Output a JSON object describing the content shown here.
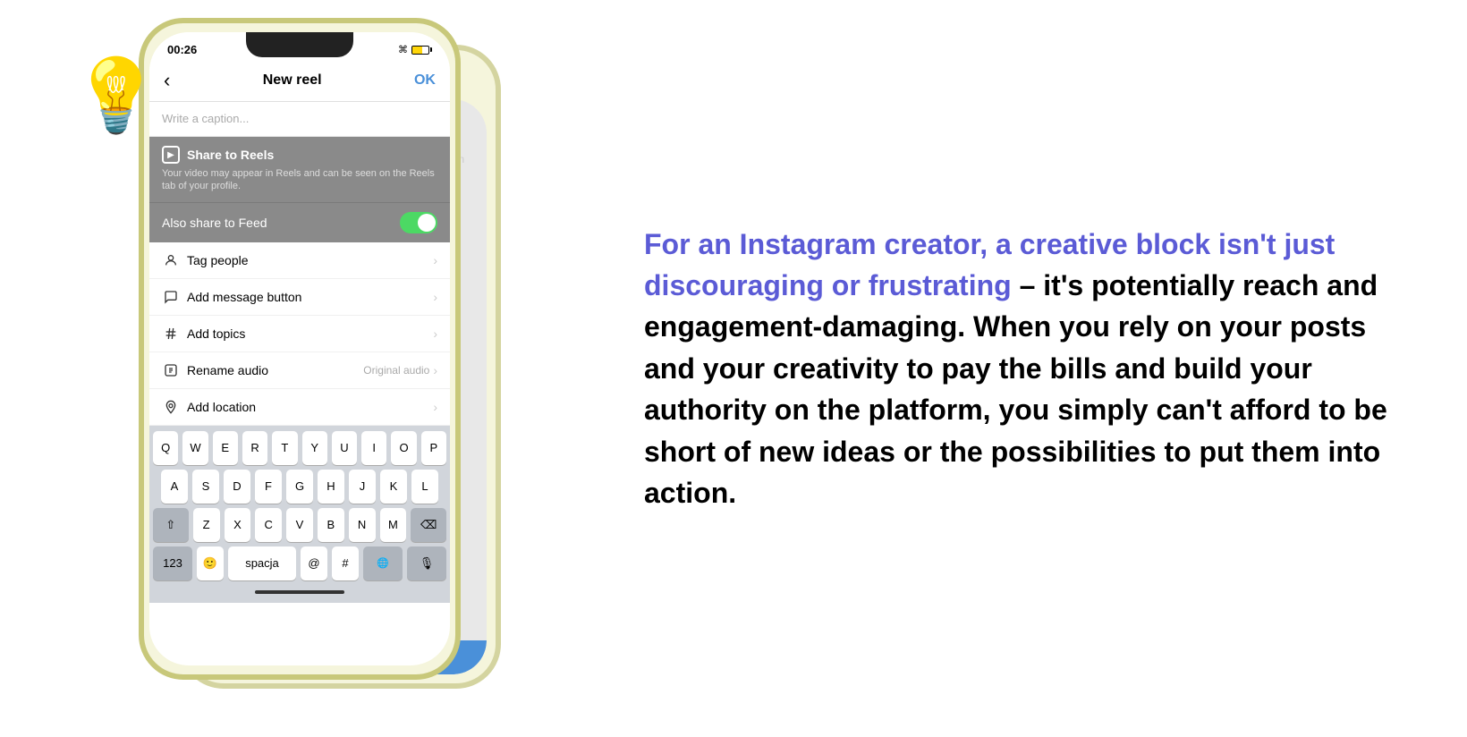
{
  "left": {
    "lightbulb": "💡",
    "phone": {
      "statusTime": "00:26",
      "statusArrow": "↑",
      "navBack": "‹",
      "navTitle": "New reel",
      "navOk": "OK",
      "captionPlaceholder": "Write a caption...",
      "shareToReels": "Share to Reels",
      "shareDesc": "Your video may appear in Reels and can be seen on the Reels tab of your profile.",
      "alsoShareFeed": "Also share to Feed",
      "menuItems": [
        {
          "icon": "👤",
          "label": "Tag people",
          "extra": ""
        },
        {
          "icon": "💬",
          "label": "Add message button",
          "extra": ""
        },
        {
          "icon": "#",
          "label": "Add topics",
          "extra": ""
        },
        {
          "icon": "🎵",
          "label": "Rename audio",
          "extra": "Original audio"
        },
        {
          "icon": "📍",
          "label": "Add location",
          "extra": ""
        }
      ],
      "keyboard": {
        "row1": [
          "Q",
          "W",
          "E",
          "R",
          "T",
          "Y",
          "U",
          "I",
          "O",
          "P"
        ],
        "row2": [
          "A",
          "S",
          "D",
          "F",
          "G",
          "H",
          "J",
          "K",
          "L"
        ],
        "row3": [
          "Z",
          "X",
          "C",
          "V",
          "B",
          "N",
          "M"
        ],
        "spaceLabel": "spacja",
        "key123": "123",
        "emojiKey": "🙂",
        "atKey": "@",
        "hashKey": "#"
      },
      "homeIndicator": ""
    }
  },
  "right": {
    "highlightText": "For an Instagram creator, a creative block isn't just discouraging or frustrating",
    "normalText": " – it's potentially reach and engagement-damaging. When you rely on your posts and your creativity to pay the bills and build your authority on the platform, you simply can't afford to be short of new ideas or the possibilities to put them into action."
  }
}
